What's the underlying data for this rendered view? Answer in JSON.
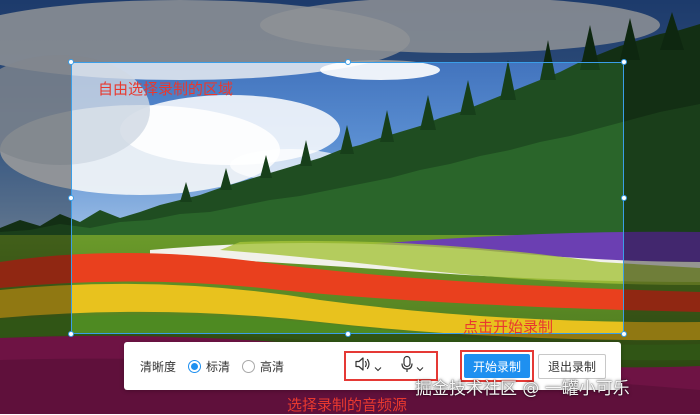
{
  "annotations": {
    "region": "自由选择录制的区域",
    "start": "点击开始录制",
    "audio": "选择录制的音频源"
  },
  "toolbar": {
    "clarity_label": "清晰度",
    "options": [
      {
        "label": "标清",
        "checked": true
      },
      {
        "label": "高清",
        "checked": false
      }
    ],
    "start_label": "开始录制",
    "exit_label": "退出录制"
  },
  "audio_sources": {
    "speaker_icon": "speaker-icon",
    "microphone_icon": "microphone-icon"
  },
  "watermark": "掘金技术社区 @ 一罐小可乐",
  "colors": {
    "accent": "#1e90f0",
    "annotation": "#e8392f",
    "highlight_border": "#e53935",
    "selection_border": "#3a9ee8"
  }
}
